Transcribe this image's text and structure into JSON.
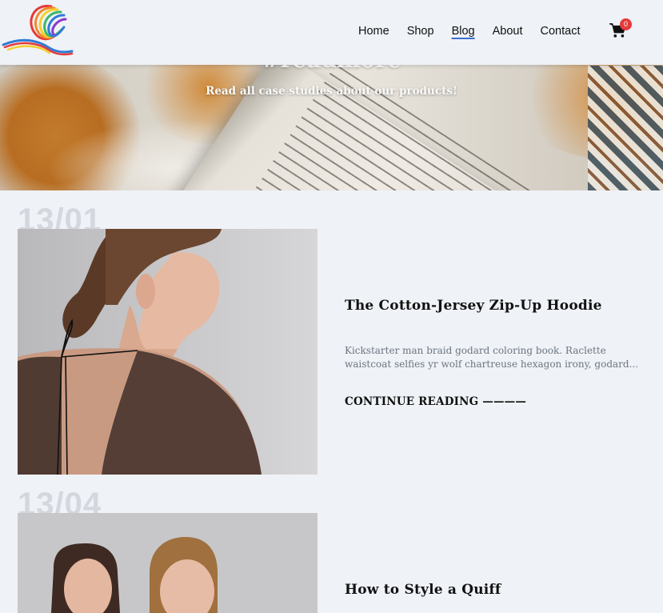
{
  "nav": {
    "items": [
      {
        "label": "Home",
        "active": false
      },
      {
        "label": "Shop",
        "active": false
      },
      {
        "label": "Blog",
        "active": true
      },
      {
        "label": "About",
        "active": false
      },
      {
        "label": "Contact",
        "active": false
      }
    ],
    "cart_icon": "shopping-cart-icon",
    "cart_count": "0"
  },
  "hero": {
    "title": "#readmore",
    "subtitle": "Read all case studies about our products!"
  },
  "posts": [
    {
      "date": "13/01",
      "title": "The Cotton-Jersey Zip-Up Hoodie",
      "excerpt": "Kickstarter man braid godard coloring book. Raclette waistcoat selfies yr wolf chartreuse hexagon irony, godard...",
      "more": "CONTINUE READING ————"
    },
    {
      "date": "13/04",
      "title": "How to Style a Quiff"
    }
  ],
  "colors": {
    "background": "#eff2f7",
    "accent_underline": "#3c6fd1",
    "badge": "#e53a3a"
  }
}
